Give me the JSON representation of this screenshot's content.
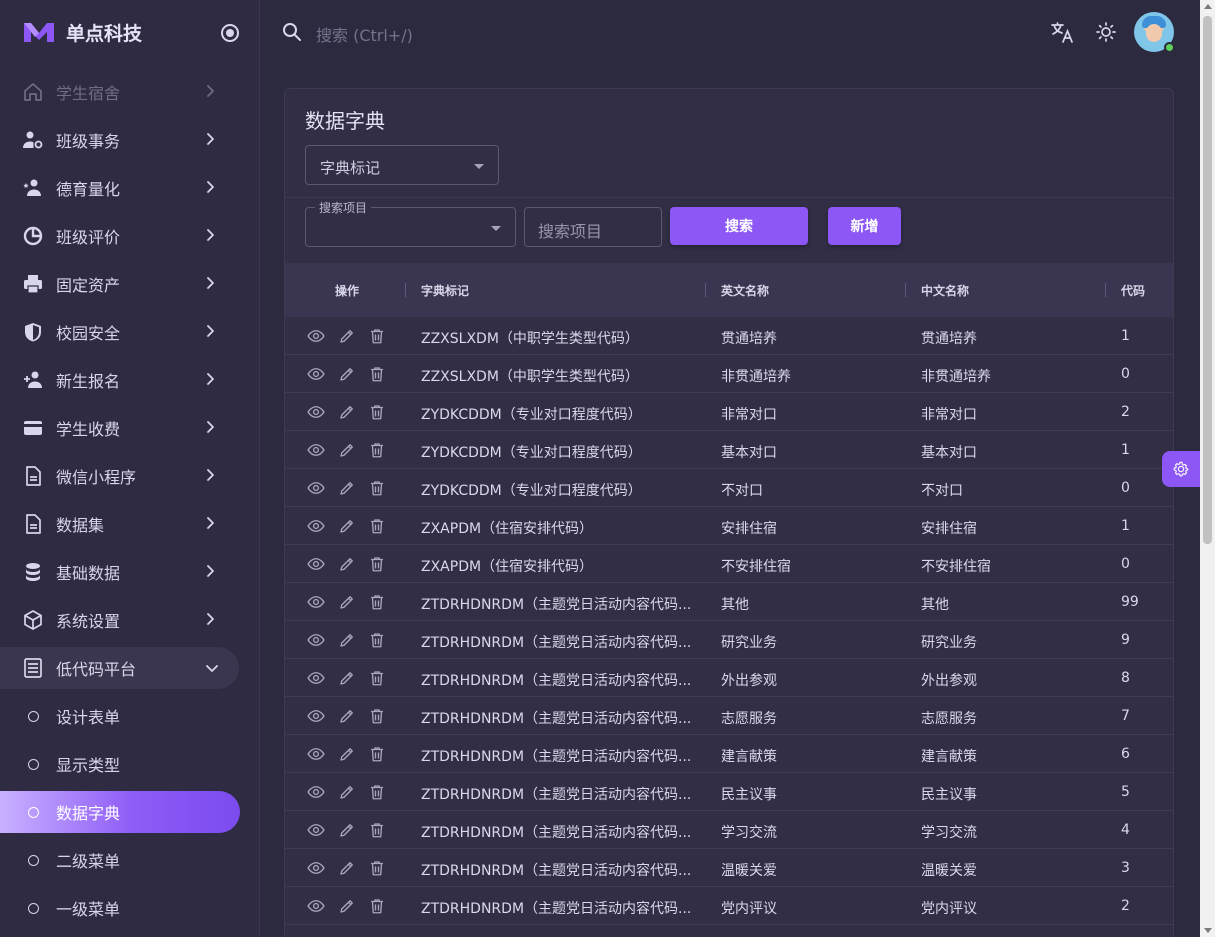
{
  "brand": {
    "name": "单点科技"
  },
  "search": {
    "placeholder": "搜索 (Ctrl+/)"
  },
  "sidebar": {
    "items": [
      {
        "label": "学生宿舍",
        "icon": "home-icon"
      },
      {
        "label": "班级事务",
        "icon": "user-cog-icon"
      },
      {
        "label": "德育量化",
        "icon": "user-star-icon"
      },
      {
        "label": "班级评价",
        "icon": "chart-donut-icon"
      },
      {
        "label": "固定资产",
        "icon": "printer-icon"
      },
      {
        "label": "校园安全",
        "icon": "shield-icon"
      },
      {
        "label": "新生报名",
        "icon": "user-add-icon"
      },
      {
        "label": "学生收费",
        "icon": "credit-card-icon"
      },
      {
        "label": "微信小程序",
        "icon": "document-icon"
      },
      {
        "label": "数据集",
        "icon": "document-icon"
      },
      {
        "label": "基础数据",
        "icon": "database-icon"
      },
      {
        "label": "系统设置",
        "icon": "cube-icon"
      },
      {
        "label": "低代码平台",
        "icon": "form-icon"
      }
    ],
    "subitems": [
      {
        "label": "设计表单"
      },
      {
        "label": "显示类型"
      },
      {
        "label": "数据字典"
      },
      {
        "label": "二级菜单"
      },
      {
        "label": "一级菜单"
      }
    ]
  },
  "card": {
    "title": "数据字典",
    "dict_select": "字典标记",
    "search_field_legend": "搜索项目",
    "search_input_placeholder": "搜索项目",
    "search_button": "搜索",
    "add_button": "新增"
  },
  "table": {
    "columns": [
      "操作",
      "字典标记",
      "英文名称",
      "中文名称",
      "代码"
    ],
    "rows": [
      {
        "tag": "ZZXSLXDM（中职学生类型代码）",
        "en": "贯通培养",
        "cn": "贯通培养",
        "code": "1"
      },
      {
        "tag": "ZZXSLXDM（中职学生类型代码）",
        "en": "非贯通培养",
        "cn": "非贯通培养",
        "code": "0"
      },
      {
        "tag": "ZYDKCDDM（专业对口程度代码）",
        "en": "非常对口",
        "cn": "非常对口",
        "code": "2"
      },
      {
        "tag": "ZYDKCDDM（专业对口程度代码）",
        "en": "基本对口",
        "cn": "基本对口",
        "code": "1"
      },
      {
        "tag": "ZYDKCDDM（专业对口程度代码）",
        "en": "不对口",
        "cn": "不对口",
        "code": "0"
      },
      {
        "tag": "ZXAPDM（住宿安排代码）",
        "en": "安排住宿",
        "cn": "安排住宿",
        "code": "1"
      },
      {
        "tag": "ZXAPDM（住宿安排代码）",
        "en": "不安排住宿",
        "cn": "不安排住宿",
        "code": "0"
      },
      {
        "tag": "ZTDRHDNRDM（主题党日活动内容代码...",
        "en": "其他",
        "cn": "其他",
        "code": "99"
      },
      {
        "tag": "ZTDRHDNRDM（主题党日活动内容代码...",
        "en": "研究业务",
        "cn": "研究业务",
        "code": "9"
      },
      {
        "tag": "ZTDRHDNRDM（主题党日活动内容代码...",
        "en": "外出参观",
        "cn": "外出参观",
        "code": "8"
      },
      {
        "tag": "ZTDRHDNRDM（主题党日活动内容代码...",
        "en": "志愿服务",
        "cn": "志愿服务",
        "code": "7"
      },
      {
        "tag": "ZTDRHDNRDM（主题党日活动内容代码...",
        "en": "建言献策",
        "cn": "建言献策",
        "code": "6"
      },
      {
        "tag": "ZTDRHDNRDM（主题党日活动内容代码...",
        "en": "民主议事",
        "cn": "民主议事",
        "code": "5"
      },
      {
        "tag": "ZTDRHDNRDM（主题党日活动内容代码...",
        "en": "学习交流",
        "cn": "学习交流",
        "code": "4"
      },
      {
        "tag": "ZTDRHDNRDM（主题党日活动内容代码...",
        "en": "温暖关爱",
        "cn": "温暖关爱",
        "code": "3"
      },
      {
        "tag": "ZTDRHDNRDM（主题党日活动内容代码...",
        "en": "党内评议",
        "cn": "党内评议",
        "code": "2"
      },
      {
        "tag": "",
        "en": "",
        "cn": "",
        "code": ""
      }
    ]
  },
  "colors": {
    "accent": "#8c57f5",
    "background": "#2b2a3f",
    "sidebar": "#2f2b42",
    "card": "#312e45"
  }
}
